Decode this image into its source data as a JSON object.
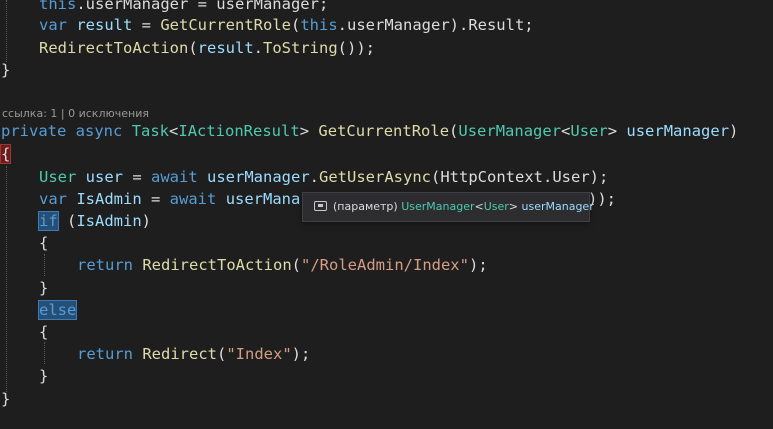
{
  "code": {
    "line1": {
      "kw": "this",
      "rest": ".userManager = userManager;"
    },
    "line2": {
      "kw": "var",
      "var": "result",
      "assign": " = ",
      "method": "GetCurrentRole",
      "open": "(",
      "kw2": "this",
      "rest": ".userManager).Result;"
    },
    "line3": {
      "method": "RedirectToAction",
      "open": "(",
      "var": "result",
      "dot": ".",
      "method2": "ToString",
      "rest": "());"
    },
    "line4": {
      "brace": "}"
    },
    "codelens": {
      "references": "ссылка: 1",
      "separator": " | ",
      "exceptions": "0 исключения"
    },
    "line5": {
      "kw1": "private",
      "kw2": "async",
      "type1": "Task",
      "lt": "<",
      "type2": "IActionResult",
      "gt": ">",
      "method": "GetCurrentRole",
      "open": "(",
      "type3": "UserManager",
      "lt2": "<",
      "type4": "User",
      "gt2": ">",
      "param": "userManager",
      "close": ")"
    },
    "line6": {
      "brace": "{"
    },
    "line7": {
      "type": "User",
      "var": "user",
      "assign": " = ",
      "kw": "await",
      "obj": "userManager",
      "dot": ".",
      "method": "GetUserAsync",
      "open": "(",
      "arg": "HttpContext.User",
      "rest": ");"
    },
    "line8": {
      "kw": "var",
      "var": "IsAdmin",
      "assign": " = ",
      "kw2": "await",
      "obj": "userMana",
      "rest": "));"
    },
    "line9": {
      "kw": "if",
      "rest": " (",
      "var": "IsAdmin",
      "close": ")"
    },
    "line10": {
      "brace": "{"
    },
    "line11": {
      "kw": "return",
      "method": "RedirectToAction",
      "open": "(",
      "str": "\"/RoleAdmin/Index\"",
      "rest": ");"
    },
    "line12": {
      "brace": "}"
    },
    "line13": {
      "kw": "else"
    },
    "line14": {
      "brace": "{"
    },
    "line15": {
      "kw": "return",
      "method": "Redirect",
      "open": "(",
      "str": "\"Index\"",
      "rest": ");"
    },
    "line16": {
      "brace": "}"
    },
    "line17": {
      "brace": "}"
    }
  },
  "tooltip": {
    "icon": "parameter-icon",
    "prefix": "(параметр) ",
    "type": "UserManager",
    "lt": "<",
    "generic": "User",
    "gt": "> ",
    "name": "userManager"
  },
  "colors": {
    "background": "#1e1e1e",
    "keyword": "#569cd6",
    "type": "#4ec9b0",
    "method": "#dcdcaa",
    "string": "#d69d85",
    "variable": "#9cdcfe",
    "text": "#dcdcdc",
    "brace_match": "#6b1d1d",
    "keyword_highlight": "#264f78"
  }
}
